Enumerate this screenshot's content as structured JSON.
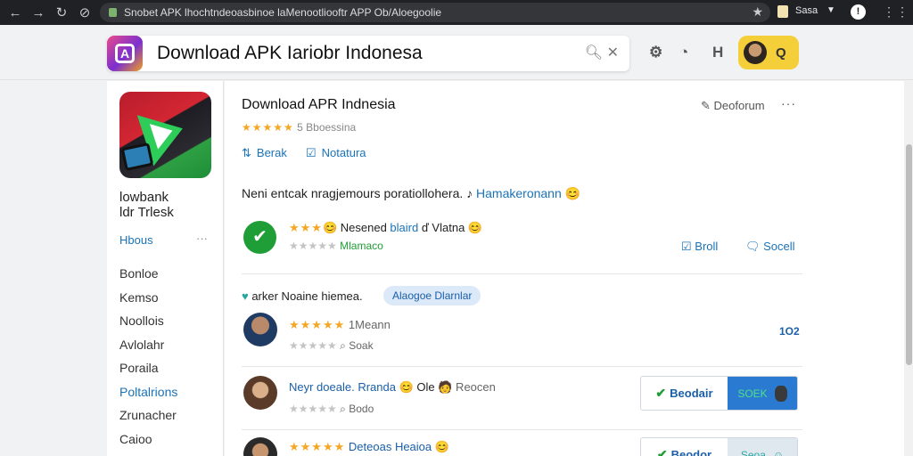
{
  "browser": {
    "url": "Snobet APK lhochtndeoasbinoe laMenootliooftr APP Ob/Aloegoolie",
    "profile_label": "Sasa"
  },
  "search": {
    "query": "Download APK Iariobr Indonesa"
  },
  "app": {
    "name_line1": "lowbank",
    "name_line2": "ldr Trlesk",
    "about_label": "Hbous",
    "about_more": "···"
  },
  "sidebar": {
    "items": [
      {
        "label": "Bonloe",
        "active": false
      },
      {
        "label": "Kemso",
        "active": false
      },
      {
        "label": "Noollois",
        "active": false
      },
      {
        "label": "Avlolahr",
        "active": false
      },
      {
        "label": "Poraila",
        "active": false
      },
      {
        "label": "Poltalrions",
        "active": true
      },
      {
        "label": "Zrunacher",
        "active": false
      },
      {
        "label": "Caioo",
        "active": false
      }
    ]
  },
  "main": {
    "title": "Download APR Indnesia",
    "rating_stars": "★★★★★",
    "rating_text": "5 Bboessina",
    "action1": "Berak",
    "action2": "Notatura",
    "top_right_button": "Deoforum",
    "top_right_more": "···",
    "description_prefix": "Neni entcak nragjemours poratiollohera. ♪ ",
    "description_link": "Hamakeronann",
    "description_emoji": "😊",
    "feature": {
      "stars_filled": "★★★",
      "stars_empty": "★★★",
      "title_prefix": "😊 Nesened ",
      "title_link": "blaird",
      "title_mid": " ď Vlatna ",
      "title_emoji": "😊",
      "sub_stars": "★★★★★",
      "sub_text": "Mlamaco",
      "right_link1": "Broll",
      "right_link2": "Socell"
    },
    "reviews_header_icon": "♥",
    "reviews_header_text": " arker Noaine hiemea.",
    "reviews_tag": "Alaogoe Dlarnlar",
    "reviews": [
      {
        "stars": "★★★★★",
        "text": "1Meann",
        "sub_stars": "★★★★★",
        "sub_text": "Soak",
        "count": "1O2"
      },
      {
        "text_blue": "Neyr doeale. Rranda",
        "text_emoji": "😊",
        "text_mid": " Ole ",
        "text_end": " Reocen",
        "sub_stars": "★★★★★",
        "sub_text": "Bodo",
        "button_left": "Beodair",
        "button_right": "SOEK"
      },
      {
        "stars": "★★★★★",
        "text_blue": "Deteoas Heaioa",
        "text_emoji": "😊",
        "button_left": "Beodor",
        "button_right": "Seoa"
      }
    ]
  },
  "colors": {
    "accent": "#1a73b8",
    "star": "#f5a623",
    "green": "#1f9d36",
    "user_pill": "#f4cf3a"
  }
}
